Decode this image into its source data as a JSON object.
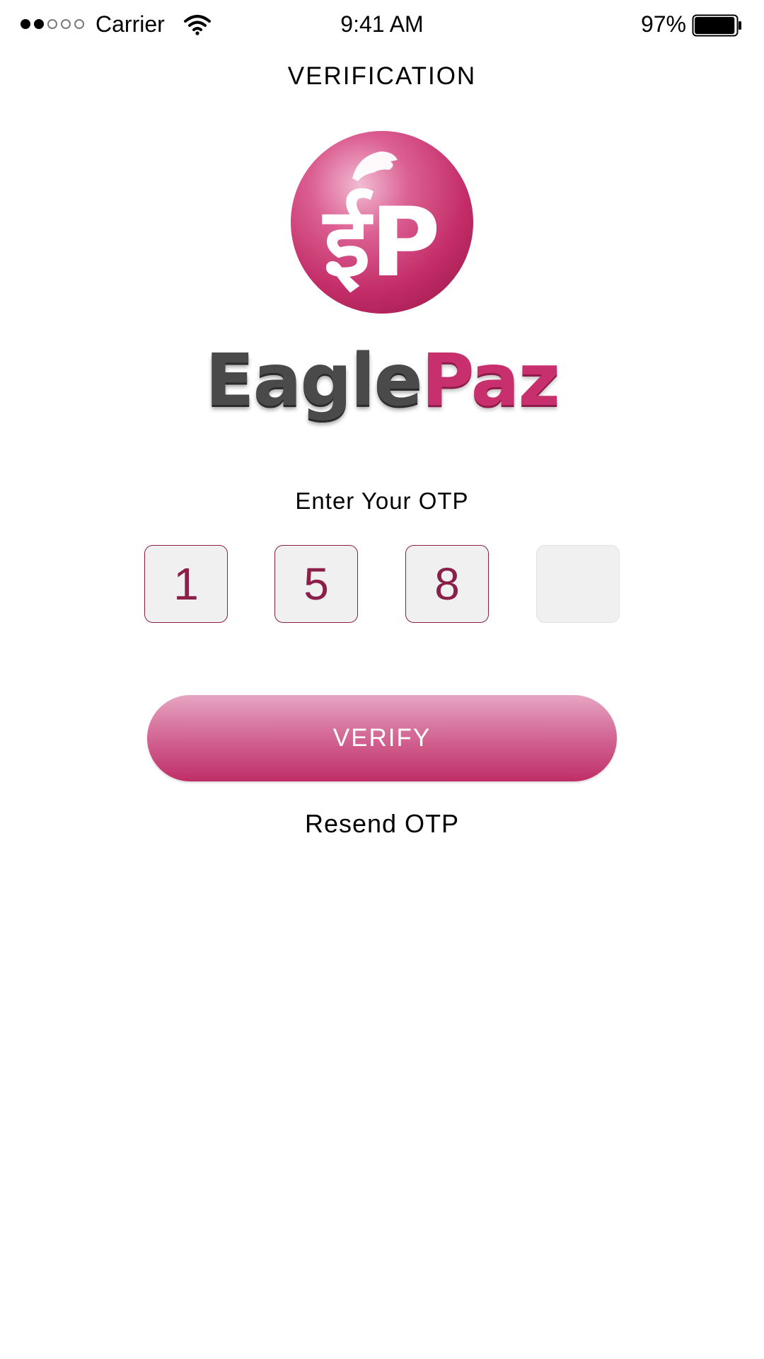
{
  "status_bar": {
    "carrier": "Carrier",
    "time": "9:41 AM",
    "battery": "97%",
    "signal_bars_filled": 2,
    "signal_bars_total": 5,
    "battery_level": 0.97,
    "icons": [
      "signal-dots-icon",
      "wifi-icon",
      "battery-icon"
    ]
  },
  "header": {
    "title": "VERIFICATION"
  },
  "logo": {
    "badge_glyph": "ईP",
    "wordmark_part_1": "Eagle",
    "wordmark_part_2": "Paz",
    "colors": {
      "brand_pink": "#c8306d",
      "brand_gray": "#4a4a4a"
    }
  },
  "otp": {
    "label": "Enter Your OTP",
    "digits": [
      "1",
      "5",
      "8",
      ""
    ],
    "colors": {
      "digit": "#8a1f4a",
      "box_fill": "#f1f0f1",
      "filled_border": "#8a1f4a",
      "empty_border": "#e2e2e2"
    }
  },
  "actions": {
    "verify_label": "VERIFY",
    "resend_label": "Resend OTP",
    "colors": {
      "button_top": "#e6a5c1",
      "button_bottom": "#bf2e66",
      "button_text": "#ffffff"
    }
  }
}
